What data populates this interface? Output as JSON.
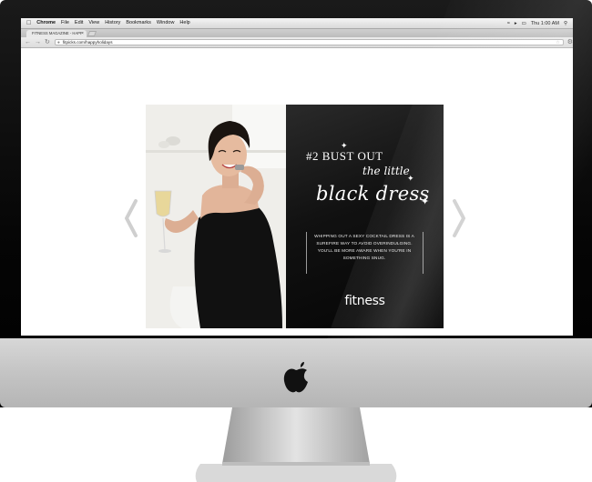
{
  "os_menubar": {
    "app_name": "Chrome",
    "menus": [
      "File",
      "Edit",
      "View",
      "History",
      "Bookmarks",
      "Window",
      "Help"
    ],
    "clock": "Thu 1:00 AM"
  },
  "browser": {
    "tab_title": "FITNESS MAGAZINE - HAPP",
    "url": "fitpicks.com/happyholidays"
  },
  "slide": {
    "headline_number": "#2",
    "headline_line1": "BUST OUT",
    "headline_line2": "the little",
    "headline_line3": "black dress",
    "body": "WHIPPING OUT A SEXY COCKTAIL DRESS IS A SUREFIRE WAY TO AVOID OVERINDULGING. YOU'LL BE MORE AWARE WHEN YOU'RE IN SOMETHING SNUG.",
    "brand": "fitness"
  },
  "colors": {
    "panel_background": "#111111",
    "bezel": "#050505",
    "chin": "#c8c8c8"
  },
  "icons": [
    "apple-icon",
    "back-icon",
    "forward-icon",
    "reload-icon",
    "star-icon",
    "wrench-icon",
    "chevron-left-icon",
    "chevron-right-icon"
  ]
}
